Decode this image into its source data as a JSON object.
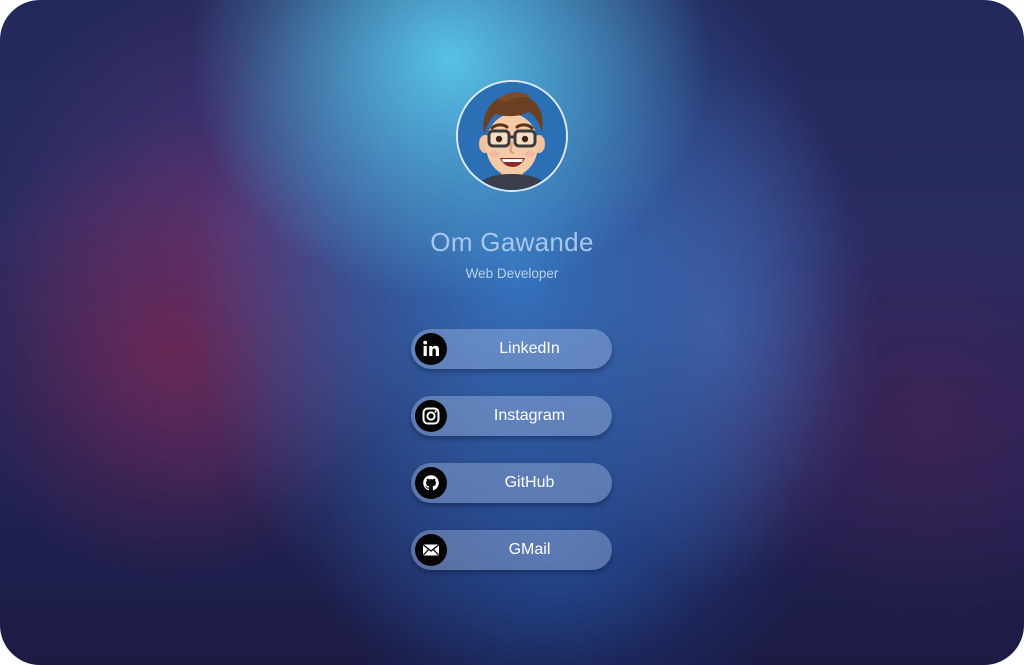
{
  "profile": {
    "avatar": "memoji-avatar",
    "name": "Om Gawande",
    "role": "Web Developer"
  },
  "links": [
    {
      "label": "LinkedIn",
      "icon": "linkedin-icon"
    },
    {
      "label": "Instagram",
      "icon": "instagram-icon"
    },
    {
      "label": "GitHub",
      "icon": "github-icon"
    },
    {
      "label": "GMail",
      "icon": "mail-icon"
    }
  ],
  "colors": {
    "avatar_background": "#2b6fb4",
    "name_text": "#a9c7ee",
    "button_text": "#ffffff",
    "icon_background": "#050505"
  }
}
